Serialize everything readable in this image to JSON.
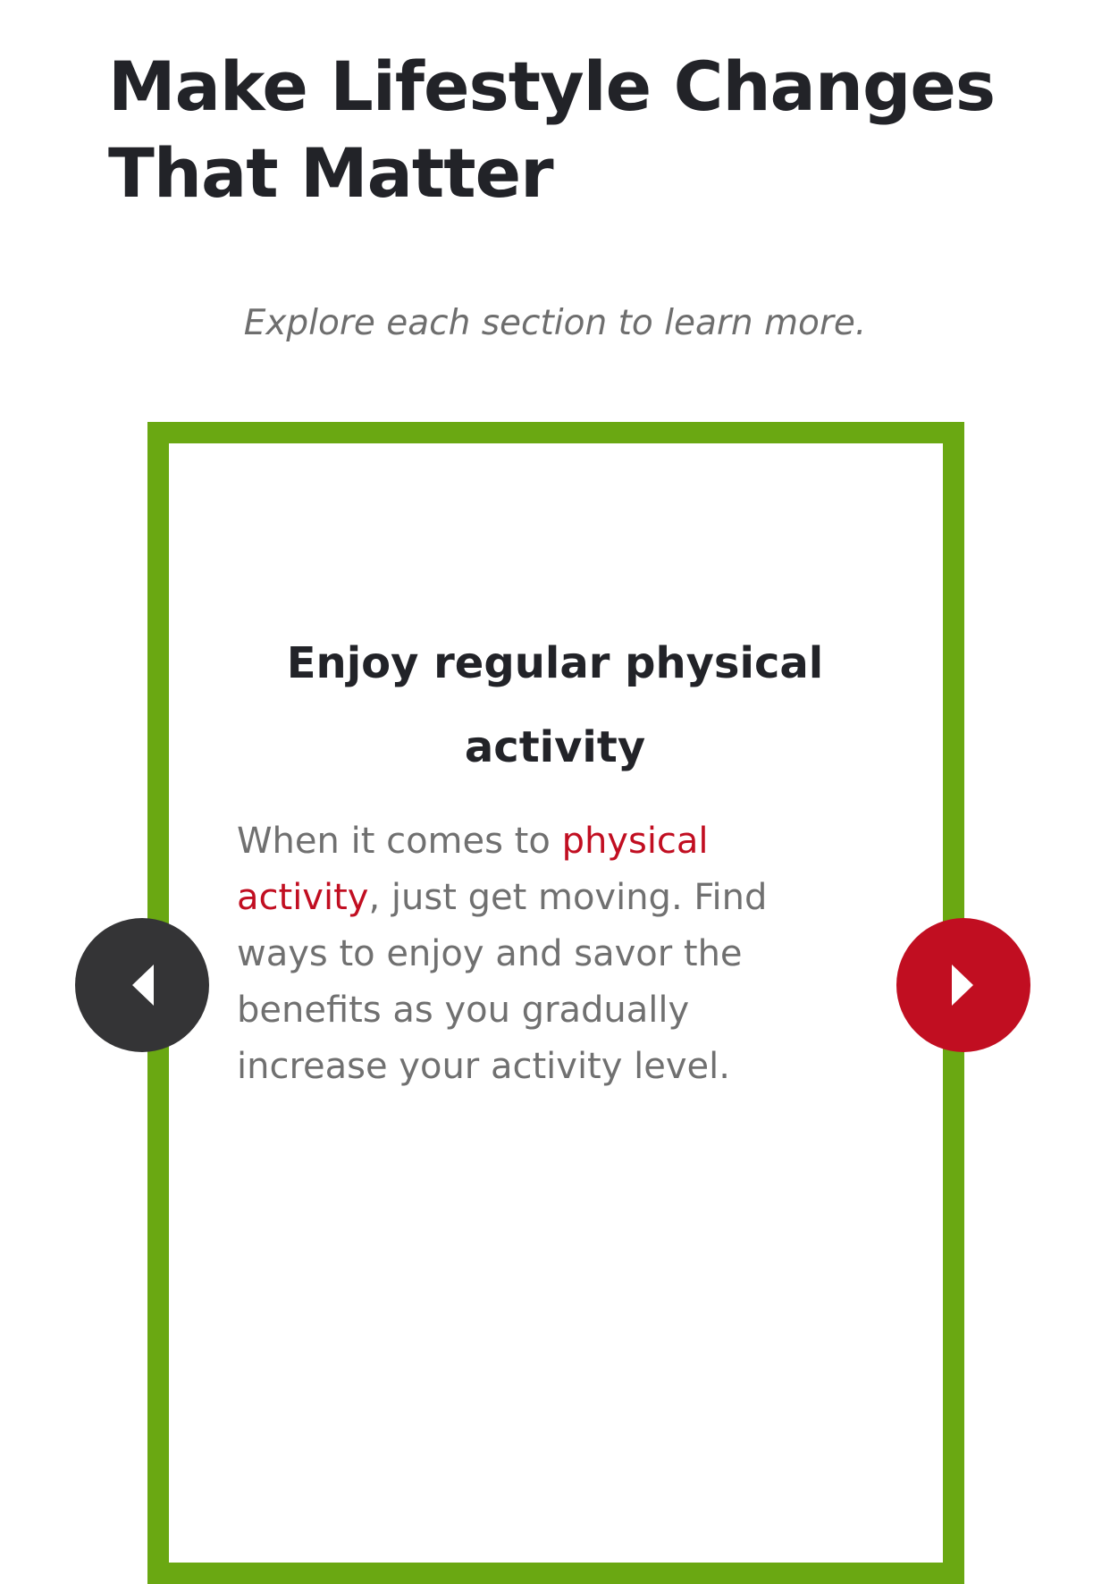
{
  "header": {
    "title_line1": "Make Lifestyle Changes",
    "title_line2": "That Matter"
  },
  "intro": {
    "subtitle": "Explore each section to learn more."
  },
  "carousel": {
    "slide": {
      "title_line1": "Enjoy regular physical",
      "title_line2": "activity",
      "body_before": "When it comes to ",
      "link_text": "physical activity",
      "body_after": ", just get moving. Find ways to enjoy and savor the benefits as you gradually increase your activity level."
    },
    "prev_icon": "caret-left-icon",
    "next_icon": "caret-right-icon"
  },
  "colors": {
    "card_border": "#6aa812",
    "accent_red": "#c10e21",
    "prev_button": "#343436",
    "heading_text": "#222328",
    "body_text": "#707070"
  }
}
